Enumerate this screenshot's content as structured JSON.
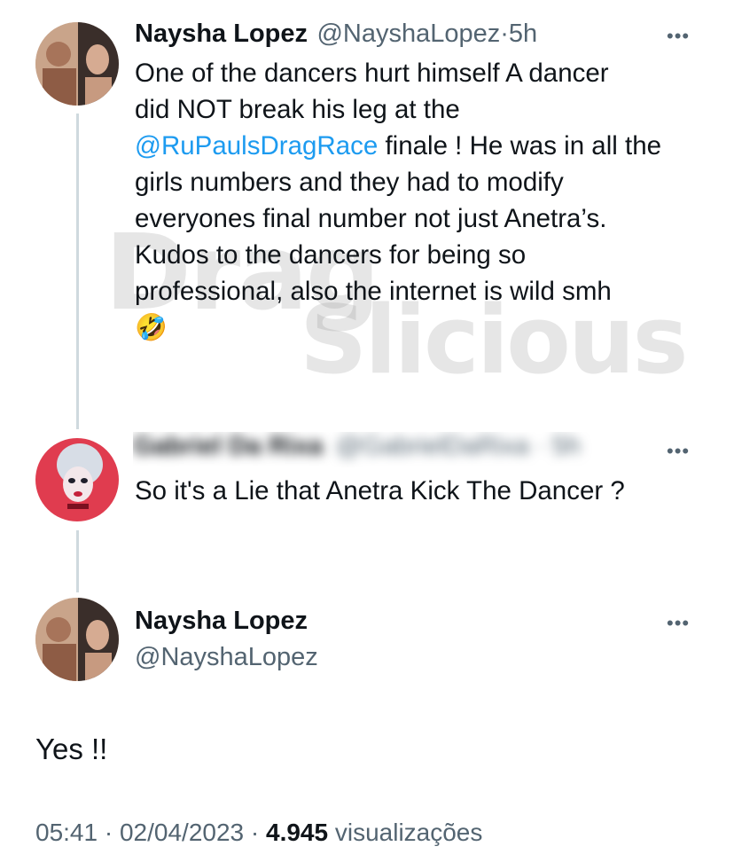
{
  "tweet1": {
    "author_name": "Naysha Lopez",
    "handle": "@NayshaLopez",
    "separator": "·",
    "time_ago": "5h",
    "line1": "One of the dancers hurt himself A dancer",
    "line2": "did NOT break his leg at the",
    "mention": "@RuPaulsDragRace",
    "line3_rest": " finale ! He was in all the",
    "line4": "girls numbers and they had to modify",
    "line5": "everyones final number not just Anetra’s.",
    "line6": "Kudos to the dancers for being so",
    "line7": "professional, also the internet is wild smh",
    "emoji": "🤣",
    "more_label": "•••"
  },
  "watermark": {
    "top": "Drag",
    "bottom": "Slicious"
  },
  "tweet2": {
    "blurred_name": "Gabriel Da Rixa",
    "blurred_handle": "@GabrielDaRixa · 5h",
    "text": "So it's a Lie that Anetra Kick The Dancer ?",
    "more_label": "•••"
  },
  "tweet3": {
    "author_name": "Naysha Lopez",
    "handle": "@NayshaLopez",
    "text": "Yes !!",
    "time": "05:41",
    "separator": "·",
    "date": "02/04/2023",
    "views_count": "4.945",
    "views_label": "visualizações",
    "more_label": "•••"
  }
}
